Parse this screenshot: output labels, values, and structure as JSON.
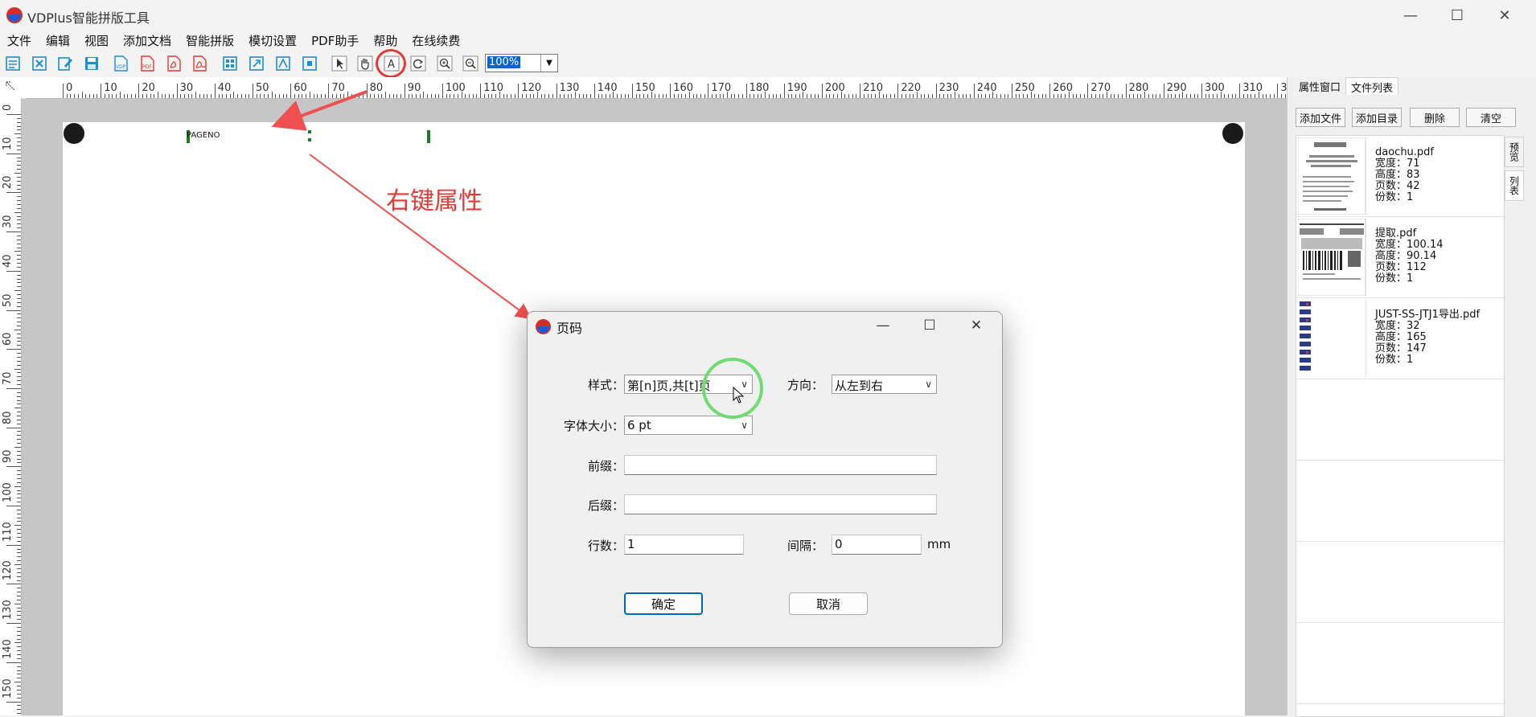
{
  "window": {
    "title": "VDPlus智能拼版工具",
    "minimize": "—",
    "maximize": "☐",
    "close": "✕"
  },
  "menu": [
    "文件",
    "编辑",
    "视图",
    "添加文档",
    "智能拼版",
    "模切设置",
    "PDF助手",
    "帮助",
    "在线续费"
  ],
  "toolbar": {
    "zoom": "100%",
    "zoom_arrow": "▼",
    "icons": [
      "new-icon",
      "close-doc-icon",
      "edit-icon",
      "save-icon",
      "vdp-icon",
      "pdf-icon",
      "acrobat-icon",
      "acrobat-export-icon",
      "layout-icon",
      "import-icon",
      "path-icon",
      "fit-icon",
      "select-icon",
      "hand-icon",
      "text-icon",
      "rotate-icon",
      "zoom-in-icon",
      "zoom-out-icon"
    ]
  },
  "ruler": {
    "h_labels": [
      "0",
      "10",
      "20",
      "30",
      "40",
      "50",
      "60",
      "70",
      "80",
      "90",
      "100",
      "110",
      "120",
      "130",
      "140",
      "150",
      "160",
      "170",
      "180",
      "190",
      "200",
      "210",
      "220",
      "230",
      "240",
      "250",
      "260",
      "270",
      "280",
      "290",
      "300",
      "310",
      "3"
    ],
    "v_labels": [
      "0",
      "10",
      "20",
      "30",
      "40",
      "50",
      "60",
      "70",
      "80",
      "90",
      "100",
      "110",
      "120",
      "130",
      "140",
      "150"
    ]
  },
  "canvas": {
    "pageno_text": "PAGENO",
    "annotation": "右键属性"
  },
  "right_panel": {
    "tabs": [
      "属性窗口",
      "文件列表"
    ],
    "buttons": [
      "添加文件",
      "添加目录",
      "删除",
      "清空"
    ],
    "side_tabs": [
      "预览",
      "列表"
    ],
    "files": [
      {
        "name": "daochu.pdf",
        "width": "宽度：71",
        "height": "高度：83",
        "pages": "页数：42",
        "copies": "份数：1"
      },
      {
        "name": "提取.pdf",
        "width": "宽度：100.14",
        "height": "高度：90.14",
        "pages": "页数：112",
        "copies": "份数：1"
      },
      {
        "name": "JUST-SS-JTJ1导出.pdf",
        "width": "宽度：32",
        "height": "高度：165",
        "pages": "页数：147",
        "copies": "份数：1"
      }
    ]
  },
  "dialog": {
    "title": "页码",
    "minimize": "—",
    "maximize": "☐",
    "close": "✕",
    "style_label": "样式：",
    "style_value": "第[n]页,共[t]页",
    "direction_label": "方向：",
    "direction_value": "从左到右",
    "fontsize_label": "字体大小：",
    "fontsize_value": "6 pt",
    "prefix_label": "前缀：",
    "prefix_value": "",
    "suffix_label": "后缀：",
    "suffix_value": "",
    "rows_label": "行数：",
    "rows_value": "1",
    "gap_label": "间隔：",
    "gap_value": "0",
    "gap_unit": "mm",
    "ok": "确定",
    "cancel": "取消",
    "arrow": "∨"
  }
}
